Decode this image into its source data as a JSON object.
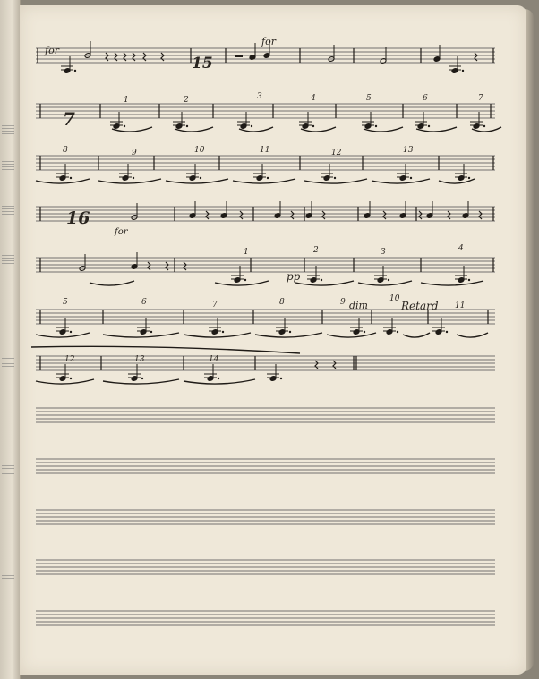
{
  "annotations": {
    "row1_left": "for",
    "row1_mid": "for",
    "row4_under": "for",
    "measure_15": "15",
    "measure_7": "7",
    "measure_16": "16",
    "row2_counts": [
      "1",
      "2",
      "3",
      "4",
      "5",
      "6",
      "7"
    ],
    "row3_counts": [
      "8",
      "9",
      "10",
      "11",
      "12",
      "13"
    ],
    "row5_counts": [
      "1",
      "2",
      "3",
      "4"
    ],
    "row6_counts": [
      "5",
      "6",
      "7",
      "8",
      "9",
      "10",
      "11"
    ],
    "row6_text_a": "dim",
    "row6_text_b": "Retard",
    "row7_counts": [
      "12",
      "13",
      "14"
    ],
    "dynamic": "pp"
  },
  "staves": {
    "written": 7,
    "blank": 5
  }
}
